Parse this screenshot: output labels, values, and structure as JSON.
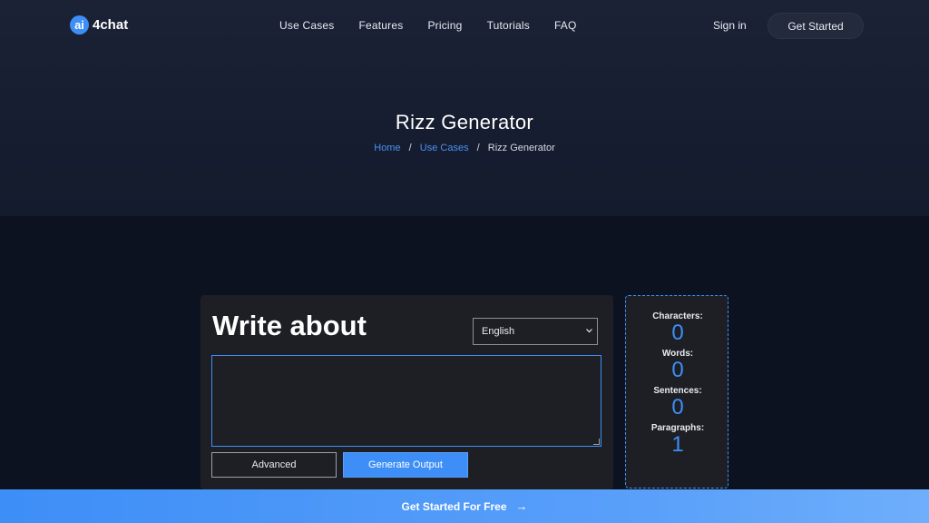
{
  "nav": {
    "logo_badge": "ai",
    "logo_text": "4chat",
    "links": [
      "Use Cases",
      "Features",
      "Pricing",
      "Tutorials",
      "FAQ"
    ],
    "sign_in": "Sign in",
    "get_started": "Get Started"
  },
  "hero": {
    "title": "Rizz Generator",
    "breadcrumb": [
      "Home",
      "Use Cases",
      "Rizz Generator"
    ]
  },
  "editor": {
    "heading": "Write about",
    "language": "English",
    "textarea_value": "",
    "advanced_label": "Advanced",
    "generate_label": "Generate Output"
  },
  "stats": [
    {
      "label": "Characters:",
      "value": "0"
    },
    {
      "label": "Words:",
      "value": "0"
    },
    {
      "label": "Sentences:",
      "value": "0"
    },
    {
      "label": "Paragraphs:",
      "value": "1"
    }
  ],
  "cta": {
    "label": "Get Started For Free",
    "arrow": "→"
  },
  "colors": {
    "accent": "#3d8ef7",
    "background": "#0c1220",
    "card": "#1e1f24"
  }
}
